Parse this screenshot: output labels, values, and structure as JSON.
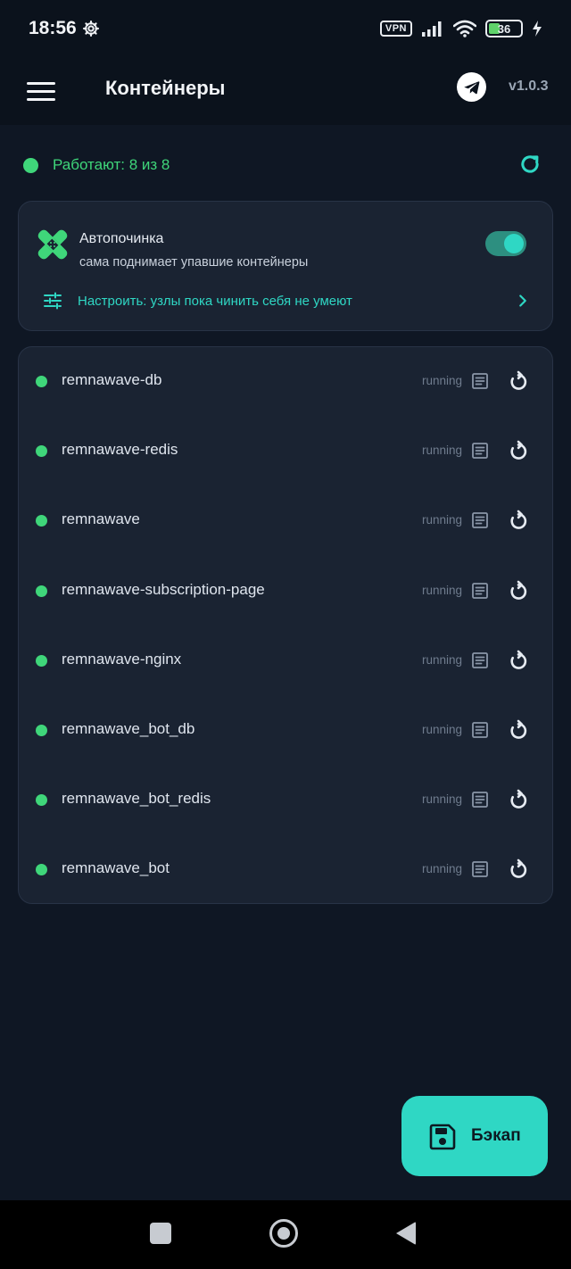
{
  "status_bar": {
    "time": "18:56",
    "vpn_label": "VPN",
    "battery_percent": "36",
    "battery_level": 0.36,
    "icons": [
      "settings-gear-icon",
      "signal-icon",
      "wifi-icon",
      "battery-icon",
      "charging-icon"
    ]
  },
  "app_bar": {
    "title": "Контейнеры",
    "version": "v1.0.3",
    "icons": [
      "hamburger-menu-icon",
      "telegram-icon"
    ]
  },
  "summary": {
    "text": "Работают: 8 из 8",
    "status_color": "#3fd67a",
    "icon": "refresh-icon"
  },
  "autorepair": {
    "title": "Автопочинка",
    "subtitle": "сама поднимает упавшие контейнеры",
    "enabled": true,
    "setup_text": "Настроить: узлы пока чинить себя не умеют",
    "icons": [
      "bandage-icon",
      "sliders-icon",
      "chevron-right-icon"
    ]
  },
  "containers": [
    {
      "name": "remnawave-db",
      "status": "running"
    },
    {
      "name": "remnawave-redis",
      "status": "running"
    },
    {
      "name": "remnawave",
      "status": "running"
    },
    {
      "name": "remnawave-subscription-page",
      "status": "running"
    },
    {
      "name": "remnawave-nginx",
      "status": "running"
    },
    {
      "name": "remnawave_bot_db",
      "status": "running"
    },
    {
      "name": "remnawave_bot_redis",
      "status": "running"
    },
    {
      "name": "remnawave_bot",
      "status": "running"
    }
  ],
  "fab": {
    "label": "Бэкап",
    "icon": "save-icon"
  },
  "colors": {
    "accent": "#2fd7c4",
    "running": "#3fd67a",
    "background": "#0f1724",
    "card": "#1a2332"
  }
}
